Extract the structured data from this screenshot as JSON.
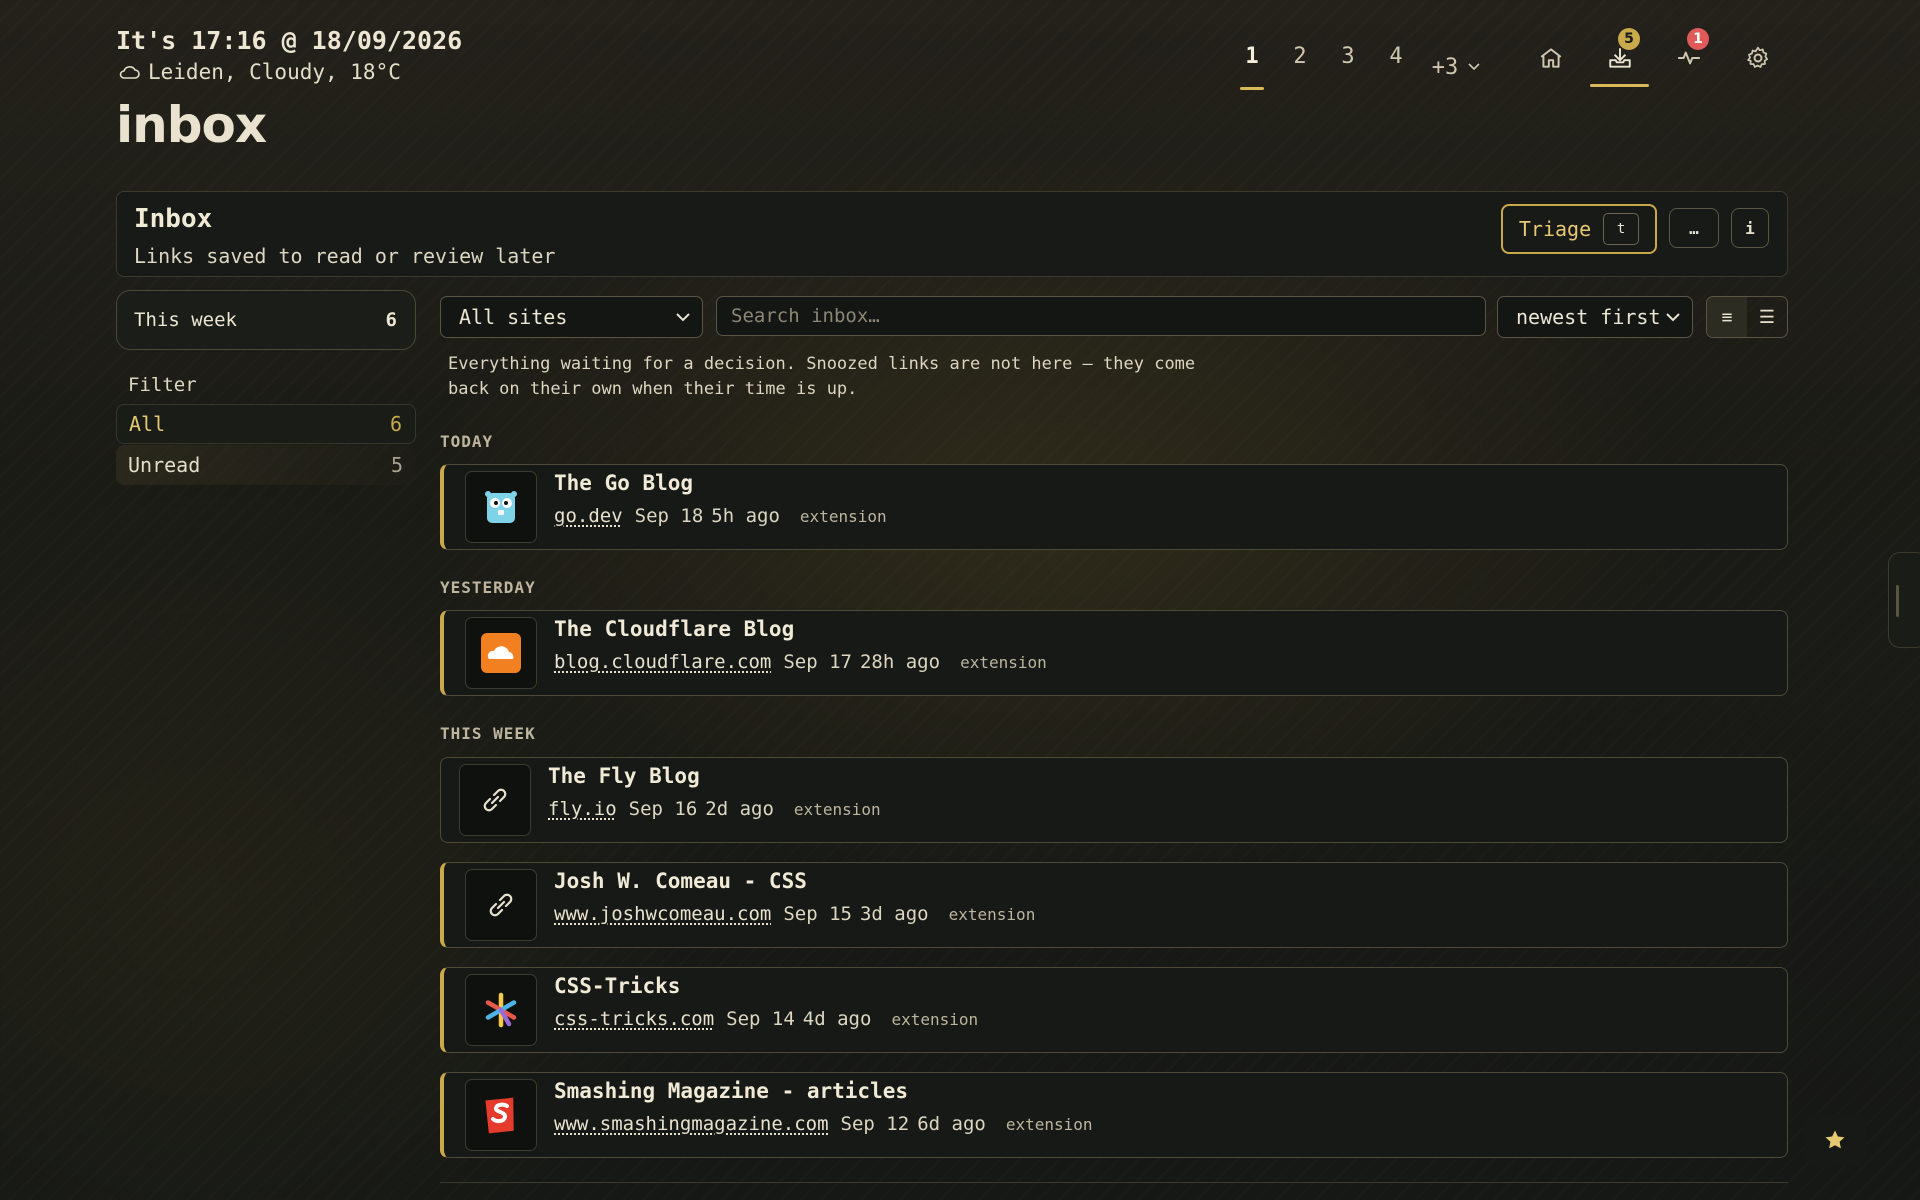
{
  "header": {
    "clock": "It's 17:16 @ 18/09/2026",
    "weather": "Leiden, Cloudy, 18°C",
    "weather_icon": "cloud-icon",
    "brand": "inbox"
  },
  "tabs": {
    "items": [
      "1",
      "2",
      "3",
      "4"
    ],
    "active": "1",
    "more": "+3"
  },
  "nav": {
    "inbox_badge": "5",
    "activity_badge": "1",
    "icons": [
      "home-icon",
      "inbox-tray-icon",
      "activity-icon",
      "gear-icon"
    ]
  },
  "page": {
    "title": "Inbox",
    "subtitle": "Links saved to read or review later",
    "triage_label": "Triage",
    "triage_key": "t",
    "more_label": "…",
    "info_label": "i"
  },
  "sidebar": {
    "period_label": "This week",
    "period_count": "6",
    "filter_label": "Filter",
    "filters": [
      {
        "label": "All",
        "count": "6"
      },
      {
        "label": "Unread",
        "count": "5"
      }
    ]
  },
  "toolbar": {
    "site_select": "All sites",
    "search_placeholder": "Search inbox…",
    "sort_select": "newest first",
    "view_compact": "≡",
    "view_list": "☰"
  },
  "note": "Everything waiting for a decision. Snoozed links are not here — they come back on their own when their time is up.",
  "groups": {
    "today": "TODAY",
    "yesterday": "YESTERDAY",
    "this_week": "THIS WEEK"
  },
  "items": [
    {
      "title": "The Go Blog",
      "domain": "go.dev",
      "date": "Sep 18",
      "age": "5h ago",
      "source": "extension"
    },
    {
      "title": "The Cloudflare Blog",
      "domain": "blog.cloudflare.com",
      "date": "Sep 17",
      "age": "28h ago",
      "source": "extension"
    },
    {
      "title": "The Fly Blog",
      "domain": "fly.io",
      "date": "Sep 16",
      "age": "2d ago",
      "source": "extension"
    },
    {
      "title": "Josh W. Comeau - CSS",
      "domain": "www.joshwcomeau.com",
      "date": "Sep 15",
      "age": "3d ago",
      "source": "extension"
    },
    {
      "title": "CSS-Tricks",
      "domain": "css-tricks.com",
      "date": "Sep 14",
      "age": "4d ago",
      "source": "extension"
    },
    {
      "title": "Smashing Magazine - articles",
      "domain": "www.smashingmagazine.com",
      "date": "Sep 12",
      "age": "6d ago",
      "source": "extension"
    }
  ],
  "colors": {
    "accent": "#c9a94a",
    "danger_badge": "#e05a5a",
    "background": "#1b1b16"
  }
}
